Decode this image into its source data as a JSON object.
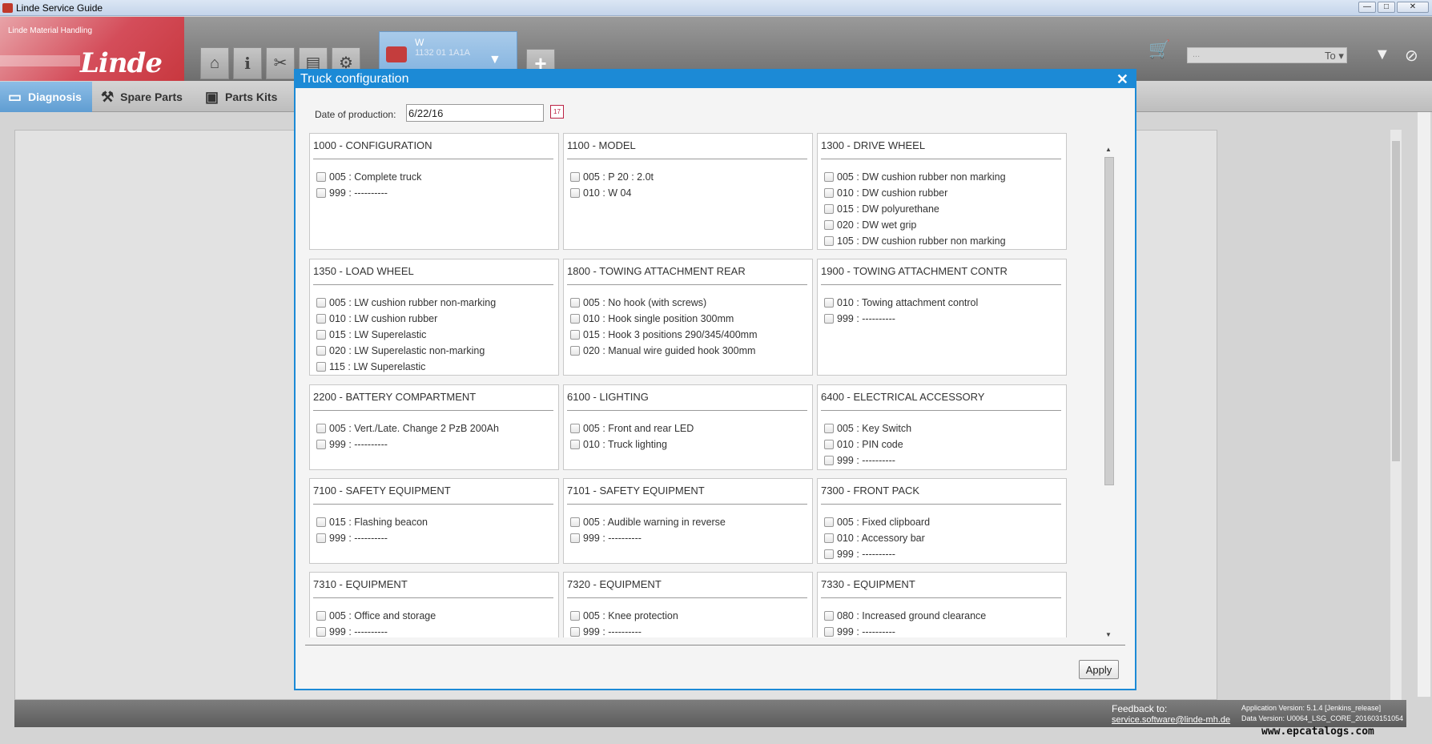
{
  "window": {
    "title": "Linde Service Guide",
    "minimize": "—",
    "maximize": "□",
    "close": "✕"
  },
  "header": {
    "logo_brand": "Linde Material Handling",
    "logo_wordmark": "Linde",
    "toolbar_icons": [
      "home-icon",
      "info-icon",
      "tools-icon",
      "toolbox-icon",
      "gear-icon"
    ],
    "truck_tab": {
      "line1": "W",
      "line2": "1132 01 1A1A"
    },
    "add_tab_label": "+",
    "search_placeholder": "...",
    "search_dropdown": "To"
  },
  "nav": {
    "items": [
      {
        "label": "Diagnosis",
        "icon": "monitor-icon",
        "active": true
      },
      {
        "label": "Spare Parts",
        "icon": "parts-icon",
        "active": false
      },
      {
        "label": "Parts Kits",
        "icon": "kit-icon",
        "active": false
      }
    ]
  },
  "modal": {
    "title": "Truck configuration",
    "close_label": "✕",
    "date_label": "Date of production:",
    "date_value": "6/22/16",
    "apply_label": "Apply",
    "groups": [
      {
        "title": "1000 - CONFIGURATION",
        "options": [
          "005 : Complete truck",
          "999 : ----------"
        ]
      },
      {
        "title": "1100 - MODEL",
        "options": [
          "005 : P 20 : 2.0t",
          "010 : W 04"
        ]
      },
      {
        "title": "1300 - DRIVE WHEEL",
        "options": [
          "005 : DW cushion rubber non marking",
          "010 : DW cushion rubber",
          "015 : DW polyurethane",
          "020 : DW wet grip",
          "105 : DW cushion rubber non marking"
        ]
      },
      {
        "title": "1350 - LOAD WHEEL",
        "options": [
          "005 : LW cushion rubber non-marking",
          "010 : LW cushion rubber",
          "015 : LW Superelastic",
          "020 : LW Superelastic non-marking",
          "115 : LW Superelastic"
        ]
      },
      {
        "title": "1800 - TOWING ATTACHMENT REAR",
        "options": [
          "005 : No hook (with screws)",
          "010 : Hook single position 300mm",
          "015 : Hook 3 positions 290/345/400mm",
          "020 : Manual wire guided hook 300mm"
        ]
      },
      {
        "title": "1900 - TOWING ATTACHMENT CONTR",
        "options": [
          "010 : Towing attachment control",
          "999 : ----------"
        ]
      },
      {
        "title": "2200 - BATTERY COMPARTMENT",
        "options": [
          "005 : Vert./Late. Change 2 PzB 200Ah",
          "999 : ----------"
        ]
      },
      {
        "title": "6100 - LIGHTING",
        "options": [
          "005 : Front and rear LED",
          "010 : Truck lighting"
        ]
      },
      {
        "title": "6400 - ELECTRICAL ACCESSORY",
        "options": [
          "005 : Key Switch",
          "010 : PIN code",
          "999 : ----------"
        ]
      },
      {
        "title": "7100 - SAFETY EQUIPMENT",
        "options": [
          "015 : Flashing beacon",
          "999 : ----------"
        ]
      },
      {
        "title": "7101 - SAFETY EQUIPMENT",
        "options": [
          "005 : Audible warning in reverse",
          "999 : ----------"
        ]
      },
      {
        "title": "7300 - FRONT PACK",
        "options": [
          "005 : Fixed clipboard",
          "010 : Accessory bar",
          "999 : ----------"
        ]
      },
      {
        "title": "7310 - EQUIPMENT",
        "options": [
          "005 : Office and storage",
          "999 : ----------"
        ]
      },
      {
        "title": "7320 - EQUIPMENT",
        "options": [
          "005 : Knee protection",
          "999 : ----------"
        ]
      },
      {
        "title": "7330 - EQUIPMENT",
        "options": [
          "080 : Increased ground clearance",
          "999 : ----------"
        ]
      }
    ]
  },
  "footer": {
    "feedback_label": "Feedback to:",
    "feedback_email": "service.software@linde-mh.de",
    "app_version": "Application Version: 5.1.4 [Jenkins_release]",
    "data_version": "Data Version: U0064_LSG_CORE_201603151054"
  },
  "watermark": "www.epcatalogs.com",
  "colors": {
    "accent": "#1c8ad6",
    "brand_red": "#c8383f",
    "nav_active": "#5f9dd2"
  }
}
